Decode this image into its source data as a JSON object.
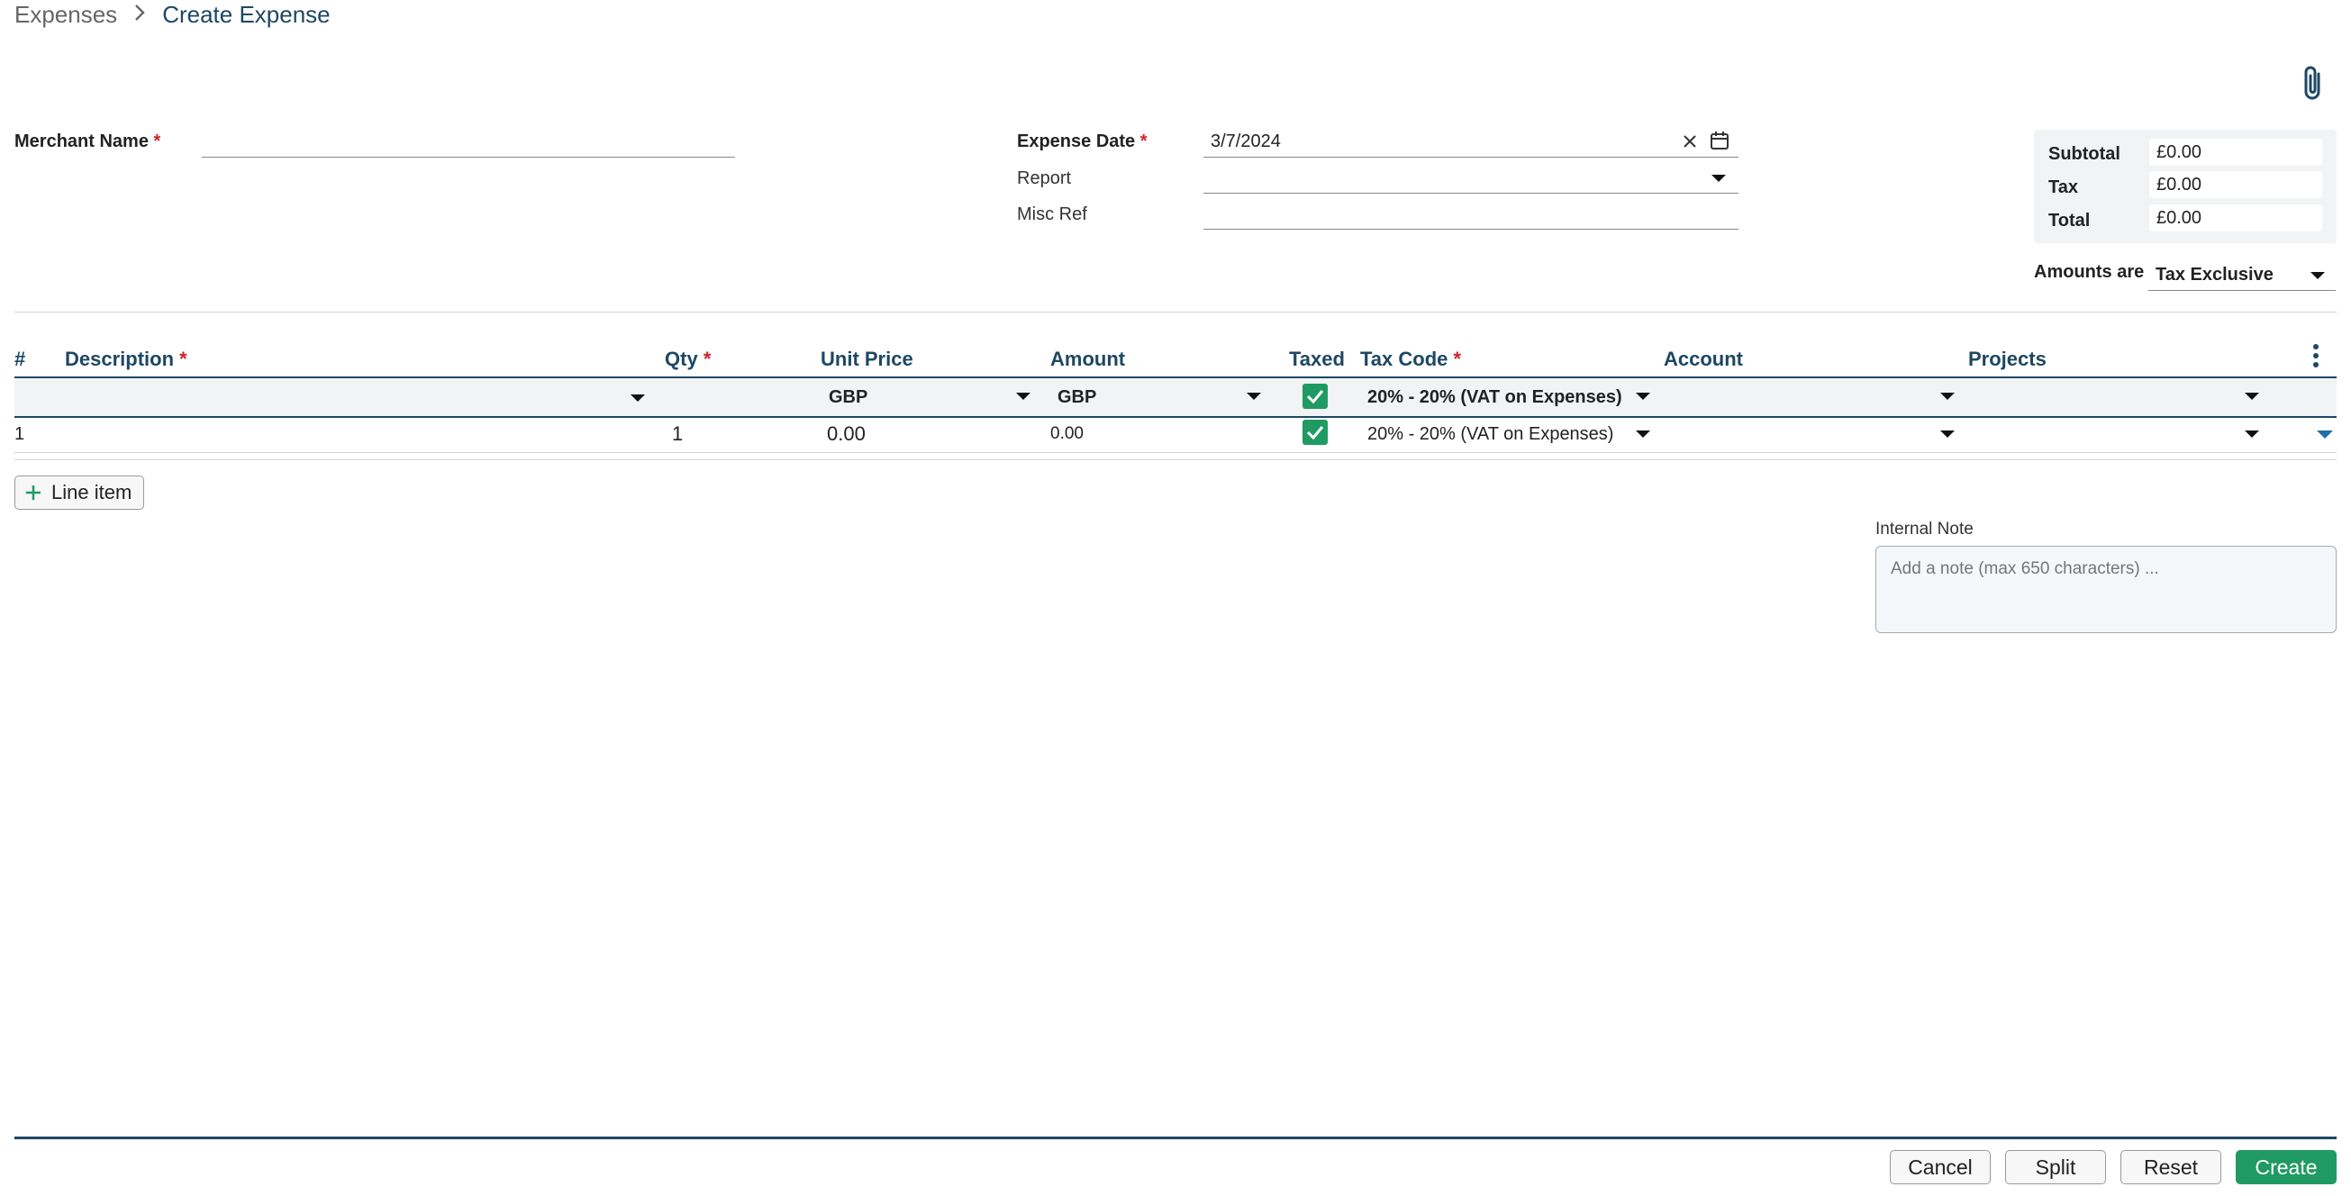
{
  "breadcrumb": {
    "parent": "Expenses",
    "current": "Create Expense"
  },
  "form": {
    "merchant_label": "Merchant Name",
    "merchant_value": "",
    "expense_date_label": "Expense Date",
    "expense_date_value": "3/7/2024",
    "report_label": "Report",
    "report_value": "",
    "misc_ref_label": "Misc Ref",
    "misc_ref_value": "",
    "required_mark": "*"
  },
  "totals": {
    "subtotal_label": "Subtotal",
    "subtotal_value": "£0.00",
    "tax_label": "Tax",
    "tax_value": "£0.00",
    "total_label": "Total",
    "total_value": "£0.00",
    "amounts_are_label": "Amounts are",
    "amounts_are_value": "Tax Exclusive"
  },
  "table": {
    "headers": {
      "num": "#",
      "description": "Description",
      "qty": "Qty",
      "unit_price": "Unit Price",
      "amount": "Amount",
      "taxed": "Taxed",
      "tax_code": "Tax Code",
      "account": "Account",
      "projects": "Projects"
    },
    "defaults": {
      "unit_price_currency": "GBP",
      "amount_currency": "GBP",
      "taxed": true,
      "tax_code": "20% - 20% (VAT on Expenses)",
      "account": "",
      "projects": ""
    },
    "rows": [
      {
        "num": "1",
        "description": "",
        "qty": "1",
        "unit_price": "0.00",
        "amount": "0.00",
        "taxed": true,
        "tax_code": "20% - 20% (VAT on Expenses)",
        "account": "",
        "projects": ""
      }
    ]
  },
  "add_line_label": "Line item",
  "internal_note": {
    "label": "Internal Note",
    "placeholder": "Add a note (max 650 characters) ..."
  },
  "footer": {
    "cancel": "Cancel",
    "split": "Split",
    "reset": "Reset",
    "create": "Create"
  },
  "colors": {
    "accent": "#1f9a63",
    "heading": "#1e4763",
    "required": "#d0222b"
  }
}
